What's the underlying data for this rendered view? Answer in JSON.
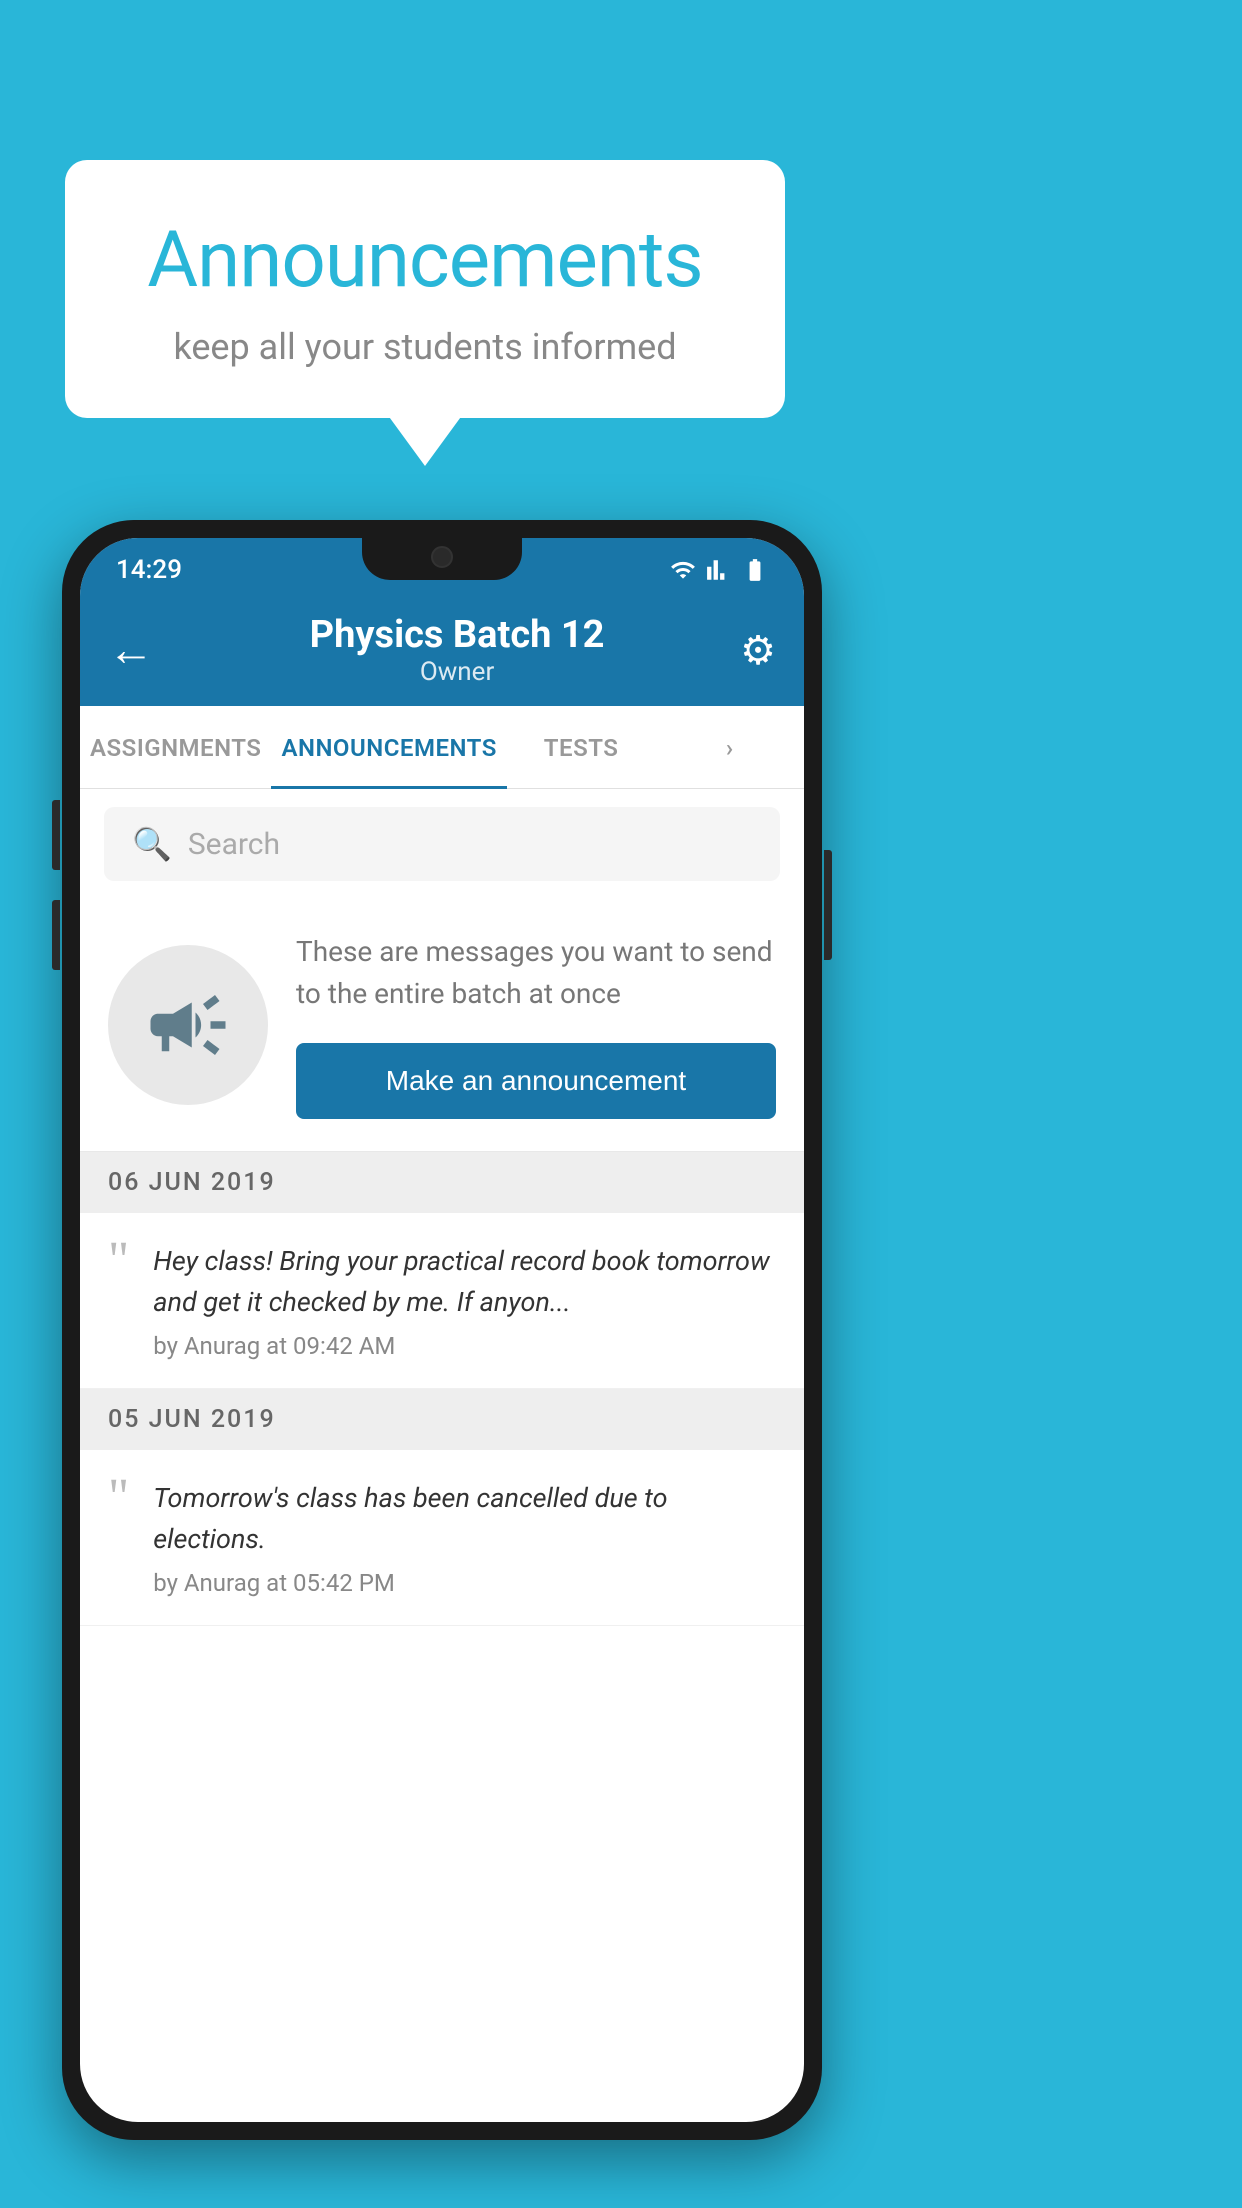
{
  "background_color": "#29b6d8",
  "speech_bubble": {
    "title": "Announcements",
    "subtitle": "keep all your students informed"
  },
  "status_bar": {
    "time": "14:29"
  },
  "app_bar": {
    "title": "Physics Batch 12",
    "subtitle": "Owner",
    "back_label": "←",
    "settings_label": "⚙"
  },
  "tabs": [
    {
      "label": "ASSIGNMENTS",
      "active": false
    },
    {
      "label": "ANNOUNCEMENTS",
      "active": true
    },
    {
      "label": "TESTS",
      "active": false
    },
    {
      "label": "",
      "active": false
    }
  ],
  "search": {
    "placeholder": "Search"
  },
  "announcement_intro": {
    "description": "These are messages you want to send to the entire batch at once",
    "button_label": "Make an announcement"
  },
  "announcements": [
    {
      "date": "06  JUN  2019",
      "message": "Hey class! Bring your practical record book tomorrow and get it checked by me. If anyon...",
      "meta": "by Anurag at 09:42 AM"
    },
    {
      "date": "05  JUN  2019",
      "message": "Tomorrow's class has been cancelled due to elections.",
      "meta": "by Anurag at 05:42 PM"
    }
  ]
}
